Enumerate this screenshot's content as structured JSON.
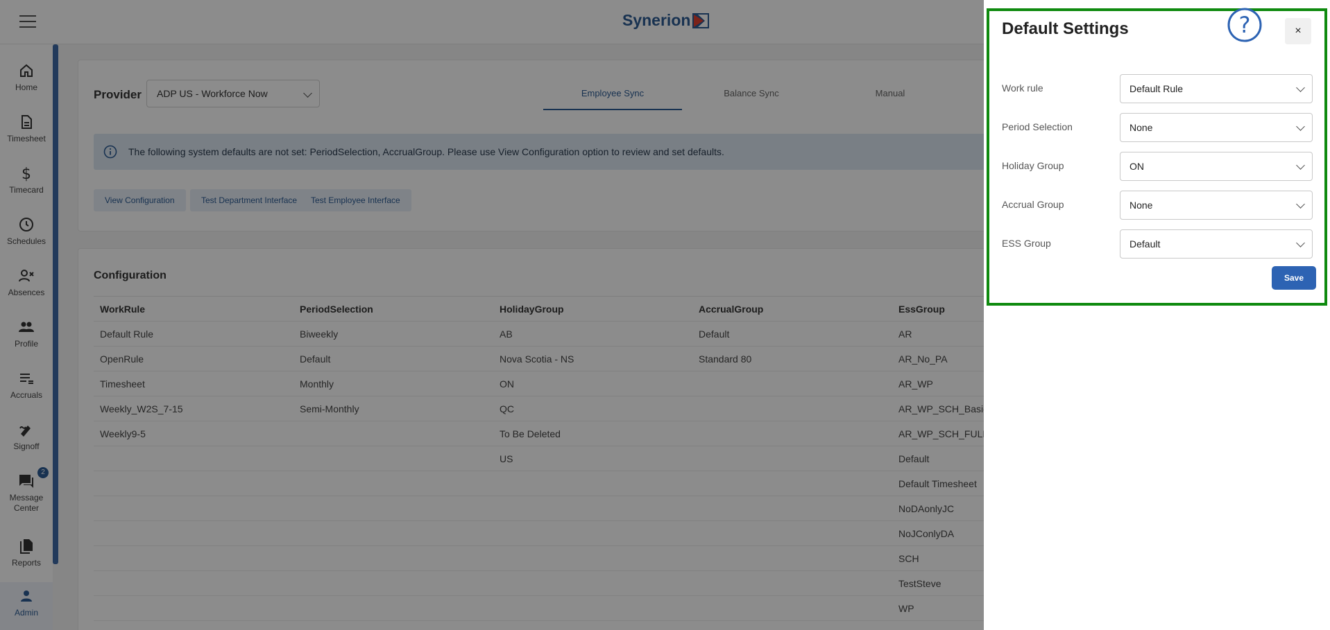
{
  "brand": {
    "name": "Synerion",
    "accent": "#2d5c94"
  },
  "sidebar": {
    "items": [
      {
        "label": "Home",
        "icon": "home-icon"
      },
      {
        "label": "Timesheet",
        "icon": "document-icon"
      },
      {
        "label": "Timecard",
        "icon": "dollar-icon"
      },
      {
        "label": "Schedules",
        "icon": "clock-icon"
      },
      {
        "label": "Absences",
        "icon": "person-x-icon"
      },
      {
        "label": "Profile",
        "icon": "people-icon"
      },
      {
        "label": "Accruals",
        "icon": "list-icon"
      },
      {
        "label": "Signoff",
        "icon": "signature-icon"
      },
      {
        "label": "Message Center",
        "icon": "chat-icon",
        "badge": "2"
      },
      {
        "label": "Reports",
        "icon": "files-icon"
      },
      {
        "label": "Admin",
        "icon": "person-icon"
      }
    ]
  },
  "provider": {
    "label": "Provider",
    "value": "ADP US - Workforce Now"
  },
  "tabs": [
    {
      "label": "Employee Sync"
    },
    {
      "label": "Balance Sync"
    },
    {
      "label": "Manual"
    }
  ],
  "alert": {
    "message": "The following system defaults are not set: PeriodSelection, AccrualGroup. Please use View Configuration option to review and set defaults."
  },
  "actions": {
    "view_config": "View Configuration",
    "test_dept": "Test Department Interface",
    "test_emp": "Test Employee Interface"
  },
  "configuration": {
    "title": "Configuration",
    "columns": [
      "WorkRule",
      "PeriodSelection",
      "HolidayGroup",
      "AccrualGroup",
      "EssGroup"
    ],
    "rows": [
      [
        "Default Rule",
        "Biweekly",
        "AB",
        "Default",
        "AR"
      ],
      [
        "OpenRule",
        "Default",
        "Nova Scotia - NS",
        "Standard 80",
        "AR_No_PA"
      ],
      [
        "Timesheet",
        "Monthly",
        "ON",
        "",
        "AR_WP"
      ],
      [
        "Weekly_W2S_7-15",
        "Semi-Monthly",
        "QC",
        "",
        "AR_WP_SCH_Basic"
      ],
      [
        "Weekly9-5",
        "",
        "To Be Deleted",
        "",
        "AR_WP_SCH_FULL"
      ],
      [
        "",
        "",
        "US",
        "",
        "Default"
      ],
      [
        "",
        "",
        "",
        "",
        "Default Timesheet"
      ],
      [
        "",
        "",
        "",
        "",
        "NoDAonlyJC"
      ],
      [
        "",
        "",
        "",
        "",
        "NoJConlyDA"
      ],
      [
        "",
        "",
        "",
        "",
        "SCH"
      ],
      [
        "",
        "",
        "",
        "",
        "TestSteve"
      ],
      [
        "",
        "",
        "",
        "",
        "WP"
      ]
    ]
  },
  "drawer": {
    "title": "Default Settings",
    "close": "×",
    "save": "Save",
    "fields": [
      {
        "label": "Work rule",
        "value": "Default Rule"
      },
      {
        "label": "Period Selection",
        "value": "None"
      },
      {
        "label": "Holiday Group",
        "value": "ON"
      },
      {
        "label": "Accrual Group",
        "value": "None"
      },
      {
        "label": "ESS Group",
        "value": "Default"
      }
    ]
  }
}
